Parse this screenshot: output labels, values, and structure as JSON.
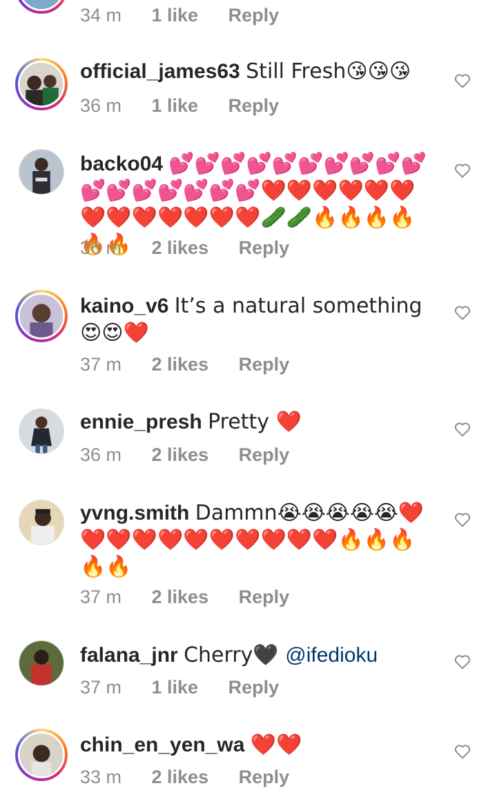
{
  "comments": [
    {
      "username": "",
      "text": "",
      "time": "34 m",
      "likes": "1 like",
      "reply": "Reply",
      "avatar": "ring"
    },
    {
      "username": "official_james63",
      "text": "Still Fresh😘😘😘",
      "time": "36 m",
      "likes": "1 like",
      "reply": "Reply",
      "avatar": "ring"
    },
    {
      "username": "backo04",
      "text": "💕💕💕💕💕💕💕💕💕💕💕💕💕💕💕💕💕❤️❤️❤️❤️❤️❤️❤️❤️❤️❤️❤️❤️❤️🥒🥒🔥🔥🔥🔥🔥🔥",
      "time": "36 m",
      "likes": "2 likes",
      "reply": "Reply",
      "avatar": "plain"
    },
    {
      "username": "kaino_v6",
      "text": "It’s a natural something 😍😍❤️",
      "time": "37 m",
      "likes": "2 likes",
      "reply": "Reply",
      "avatar": "ring"
    },
    {
      "username": "ennie_presh",
      "text": "Pretty ❤️",
      "time": "36 m",
      "likes": "2 likes",
      "reply": "Reply",
      "avatar": "plain"
    },
    {
      "username": "yvng.smith",
      "text": "Dammn😭😭😭😭😭❤️❤️❤️❤️❤️❤️❤️❤️❤️❤️❤️🔥🔥🔥🔥🔥",
      "time": "37 m",
      "likes": "2 likes",
      "reply": "Reply",
      "avatar": "plain"
    },
    {
      "username": "falana_jnr",
      "text": "Cherry🖤 ",
      "mention": "@ifedioku",
      "time": "37 m",
      "likes": "1 like",
      "reply": "Reply",
      "avatar": "plain"
    },
    {
      "username": "chin_en_yen_wa",
      "text": "❤️❤️",
      "time": "33 m",
      "likes": "2 likes",
      "reply": "Reply",
      "avatar": "ring"
    }
  ],
  "icons": {
    "like": "heart-outline-icon"
  },
  "colors": {
    "meta": "#8e8e8e",
    "text": "#262626",
    "mention": "#00376b",
    "story_ring": [
      "#feda75",
      "#fa7e1e",
      "#d62976",
      "#962fbf"
    ]
  }
}
